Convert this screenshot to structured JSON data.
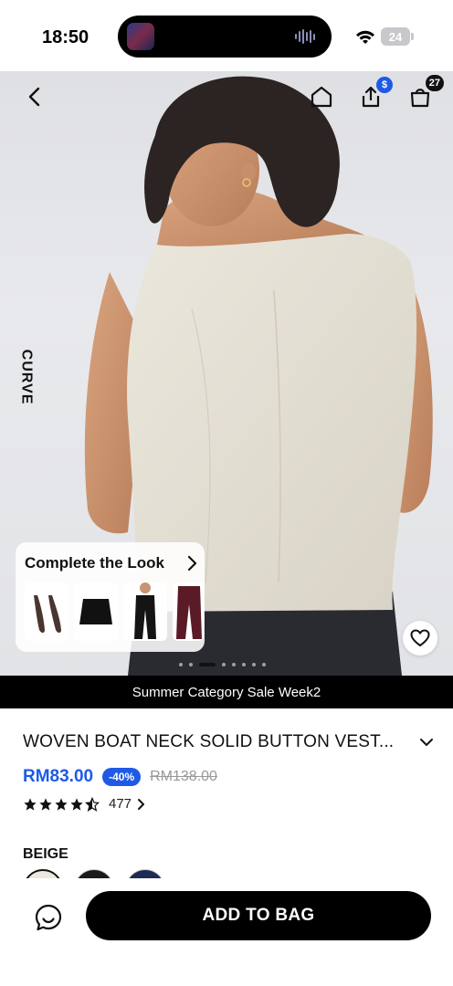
{
  "status_bar": {
    "time": "18:50",
    "battery_level": "24",
    "icons": [
      "wifi-icon",
      "battery-icon"
    ]
  },
  "nav": {
    "icons": [
      "chevron-left-icon",
      "home-icon",
      "share-icon",
      "shopping-bag-icon"
    ],
    "share_badge": "$",
    "bag_count": "27"
  },
  "gallery": {
    "side_label": "CURVE",
    "complete_look": {
      "title": "Complete the Look",
      "items": [
        "pointed-flats-icon",
        "black-skirt-icon",
        "black-trousers-icon",
        "burgundy-trousers-icon"
      ]
    },
    "image_count": 8,
    "active_image_index": 3
  },
  "promo": {
    "text": "Summer Category Sale Week2"
  },
  "product": {
    "title": "WOVEN BOAT NECK SOLID BUTTON VEST...",
    "price": "RM83.00",
    "discount": "-40%",
    "original_price": "RM138.00",
    "rating": 4.5,
    "review_count": "477",
    "color_label": "BEIGE",
    "swatches": [
      "#ece8df",
      "#1a1a1a",
      "#1d2a55"
    ]
  },
  "actions": {
    "add_to_bag": "ADD TO BAG"
  },
  "colors": {
    "accent": "#1e5ae6",
    "promo_bg": "#000000",
    "button_bg": "#000000"
  }
}
